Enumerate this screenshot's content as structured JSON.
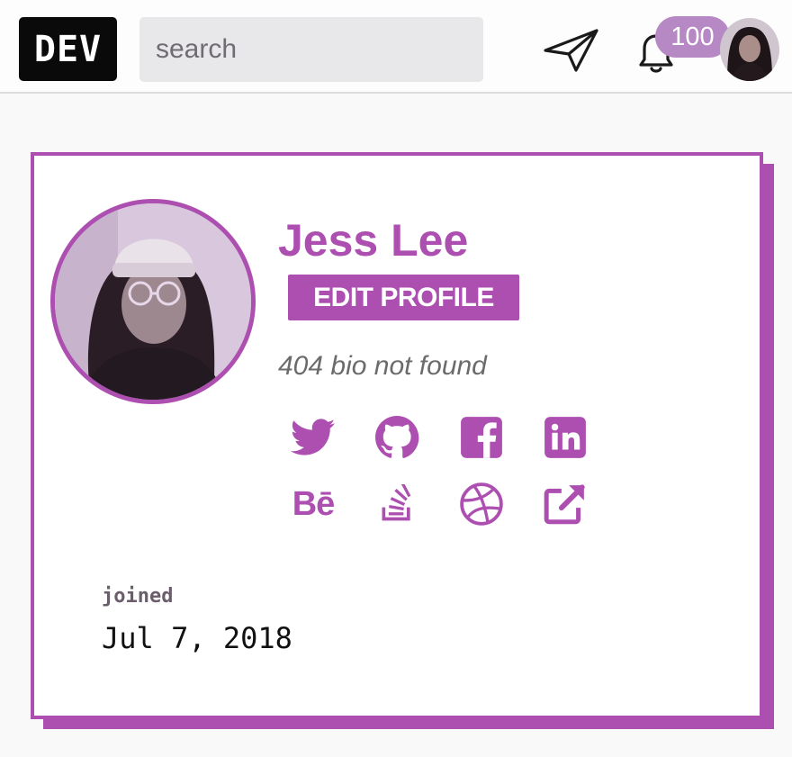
{
  "nav": {
    "logo_text": "DEV",
    "search_placeholder": "search",
    "notification_count": "100",
    "icons": [
      "send-icon",
      "bell-icon"
    ]
  },
  "profile": {
    "name": "Jess Lee",
    "edit_label": "EDIT PROFILE",
    "bio": "404 bio not found",
    "social_links": [
      {
        "name": "twitter-icon",
        "label": "Twitter"
      },
      {
        "name": "github-icon",
        "label": "GitHub"
      },
      {
        "name": "facebook-icon",
        "label": "Facebook"
      },
      {
        "name": "linkedin-icon",
        "label": "LinkedIn"
      },
      {
        "name": "behance-icon",
        "label": "Bē"
      },
      {
        "name": "stackoverflow-icon",
        "label": "Stack Overflow"
      },
      {
        "name": "dribbble-icon",
        "label": "Dribbble"
      },
      {
        "name": "external-link-icon",
        "label": "Website"
      }
    ],
    "joined_label": "joined",
    "joined_date": "Jul 7, 2018"
  },
  "colors": {
    "accent": "#ad4fb0",
    "badge": "#b789c4",
    "logo_bg": "#0a0a0a",
    "search_bg": "#e8e7e9",
    "page_bg": "#f9f9fa"
  }
}
